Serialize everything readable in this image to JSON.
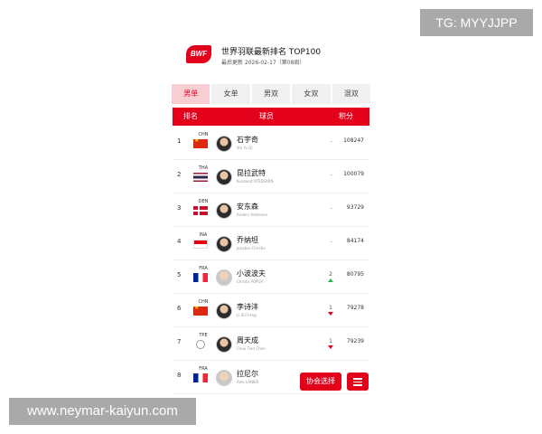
{
  "watermarks": {
    "top_right": "TG: MYYJJPP",
    "bottom_left": "www.neymar-kaiyun.com"
  },
  "header": {
    "logo_text": "BWF",
    "title": "世界羽联最新排名 TOP100",
    "updated": "最后更新 2026-02-17（第08周）",
    "brand_color": "#e3001b"
  },
  "tabs": [
    {
      "label": "男单",
      "active": true
    },
    {
      "label": "女单",
      "active": false
    },
    {
      "label": "男双",
      "active": false
    },
    {
      "label": "女双",
      "active": false
    },
    {
      "label": "混双",
      "active": false
    }
  ],
  "table": {
    "headers": {
      "rank": "排名",
      "player": "球员",
      "points": "积分"
    },
    "rows": [
      {
        "rank": "1",
        "country": "CHN",
        "flag": "chn",
        "name": "石宇奇",
        "name_en": "Shi Yu Qi",
        "change": "-",
        "trend": "none",
        "points": "108247"
      },
      {
        "rank": "2",
        "country": "THA",
        "flag": "tha",
        "name": "昆拉武特",
        "name_en": "Kunlavut VITIDSARN",
        "change": "-",
        "trend": "none",
        "points": "100079"
      },
      {
        "rank": "3",
        "country": "DEN",
        "flag": "den",
        "name": "安东森",
        "name_en": "Anders Antonsen",
        "change": "-",
        "trend": "none",
        "points": "93729"
      },
      {
        "rank": "4",
        "country": "INA",
        "flag": "ina",
        "name": "乔纳坦",
        "name_en": "Jonatan Christie",
        "change": "-",
        "trend": "none",
        "points": "84174"
      },
      {
        "rank": "5",
        "country": "FRA",
        "flag": "fra",
        "name": "小波波夫",
        "name_en": "Christo POPOV",
        "change": "2",
        "trend": "up",
        "points": "80795"
      },
      {
        "rank": "6",
        "country": "CHN",
        "flag": "chn",
        "name": "李诗沣",
        "name_en": "Li Shi Feng",
        "change": "1",
        "trend": "down",
        "points": "79278"
      },
      {
        "rank": "7",
        "country": "TPE",
        "flag": "tpe",
        "name": "周天成",
        "name_en": "Chou Tien Chen",
        "change": "1",
        "trend": "down",
        "points": "79239"
      },
      {
        "rank": "8",
        "country": "FRA",
        "flag": "fra",
        "name": "拉尼尔",
        "name_en": "Alex LANIER",
        "change": "",
        "trend": "none",
        "points": ""
      }
    ]
  },
  "footer": {
    "association_button": "协会选择",
    "menu_icon": "list-menu-icon"
  }
}
